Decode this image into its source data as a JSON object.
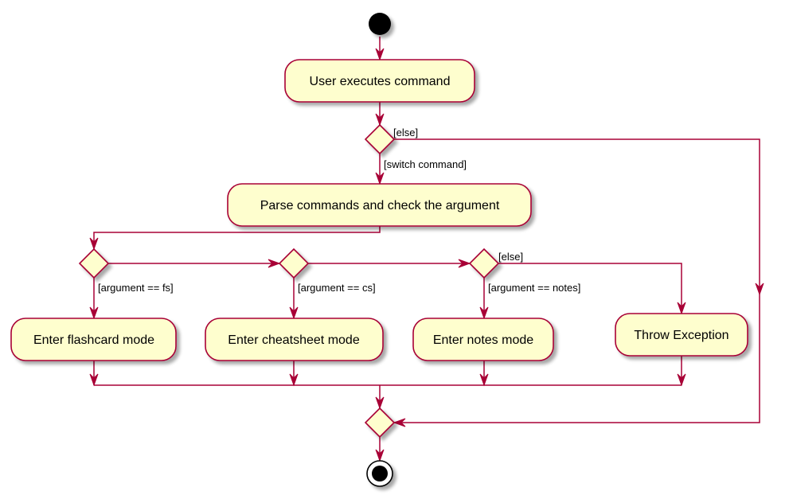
{
  "diagram": {
    "type": "uml-activity",
    "colors": {
      "line": "#A80036",
      "node_fill": "#FEFECE",
      "start": "#000000"
    },
    "nodes": {
      "user_executes": "User executes command",
      "parse": "Parse commands and check the argument",
      "flashcard": "Enter flashcard mode",
      "cheatsheet": "Enter cheatsheet mode",
      "notes": "Enter notes mode",
      "exception": "Throw Exception"
    },
    "guards": {
      "top_else": "[else]",
      "switch": "[switch command]",
      "fs": "[argument == fs]",
      "cs": "[argument == cs]",
      "notes": "[argument == notes]",
      "inner_else": "[else]"
    }
  }
}
